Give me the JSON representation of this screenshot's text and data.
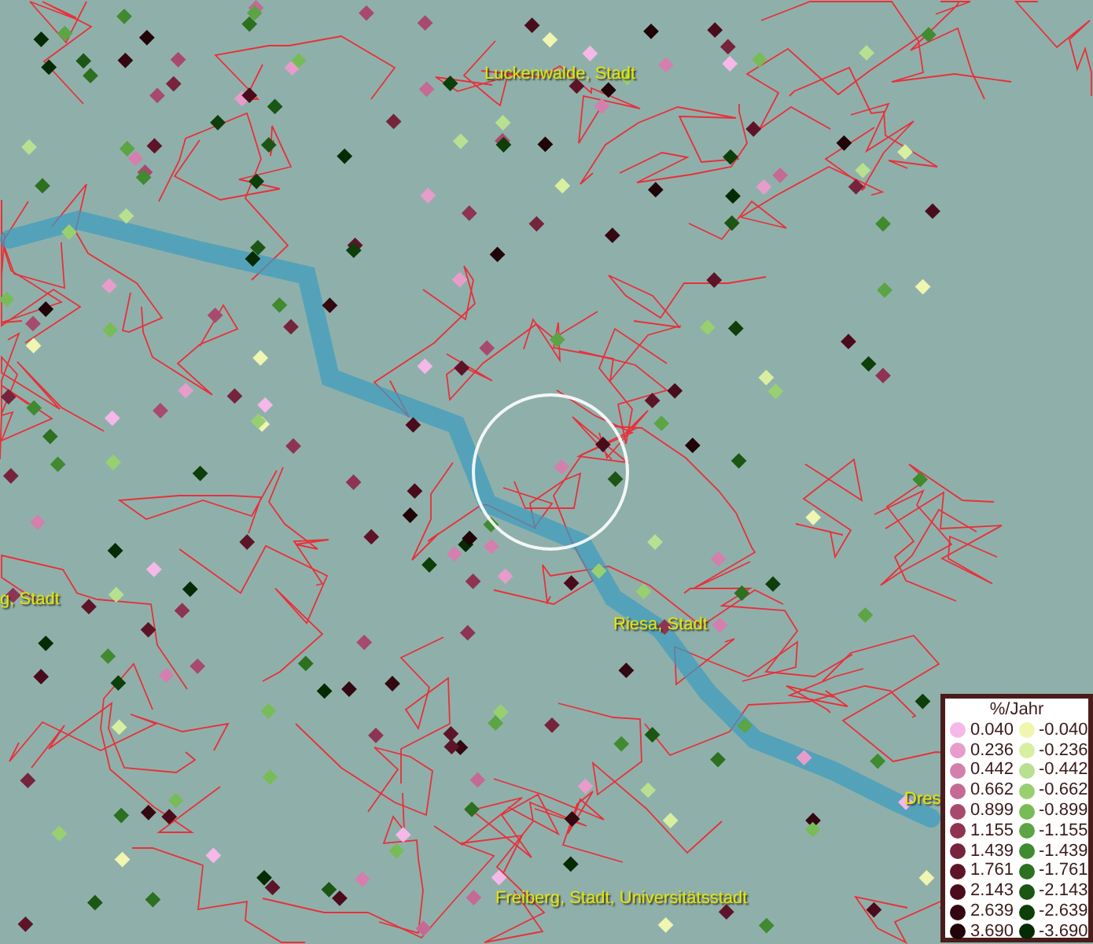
{
  "places": [
    {
      "name": "Luckenwalde, Stadt"
    },
    {
      "name": "g, Stadt"
    },
    {
      "name": "Riesa, Stadt"
    },
    {
      "name": "Dres"
    },
    {
      "name": "Freiberg, Stadt, Universitätsstadt"
    }
  ],
  "legend": {
    "title": "%/Jahr",
    "positive": [
      {
        "value": "0.040",
        "color": "#f5b8e8"
      },
      {
        "value": "0.236",
        "color": "#e89ccc"
      },
      {
        "value": "0.442",
        "color": "#d47fae"
      },
      {
        "value": "0.662",
        "color": "#c46a94"
      },
      {
        "value": "0.899",
        "color": "#a84a6e"
      },
      {
        "value": "1.155",
        "color": "#8e3452"
      },
      {
        "value": "1.439",
        "color": "#75243c"
      },
      {
        "value": "1.761",
        "color": "#5e1428"
      },
      {
        "value": "2.143",
        "color": "#4a0c1c"
      },
      {
        "value": "2.639",
        "color": "#340810"
      },
      {
        "value": "3.690",
        "color": "#200408"
      }
    ],
    "negative": [
      {
        "value": "-0.040",
        "color": "#f0f5b0"
      },
      {
        "value": "-0.236",
        "color": "#d8efa0"
      },
      {
        "value": "-0.442",
        "color": "#b8e090"
      },
      {
        "value": "-0.662",
        "color": "#98d070"
      },
      {
        "value": "-0.899",
        "color": "#78bc58"
      },
      {
        "value": "-1.155",
        "color": "#5ca444"
      },
      {
        "value": "-1.439",
        "color": "#408a30"
      },
      {
        "value": "-1.761",
        "color": "#2c7020"
      },
      {
        "value": "-2.143",
        "color": "#1c5614"
      },
      {
        "value": "-2.639",
        "color": "#0e3e0a"
      },
      {
        "value": "-3.690",
        "color": "#062a04"
      }
    ]
  }
}
